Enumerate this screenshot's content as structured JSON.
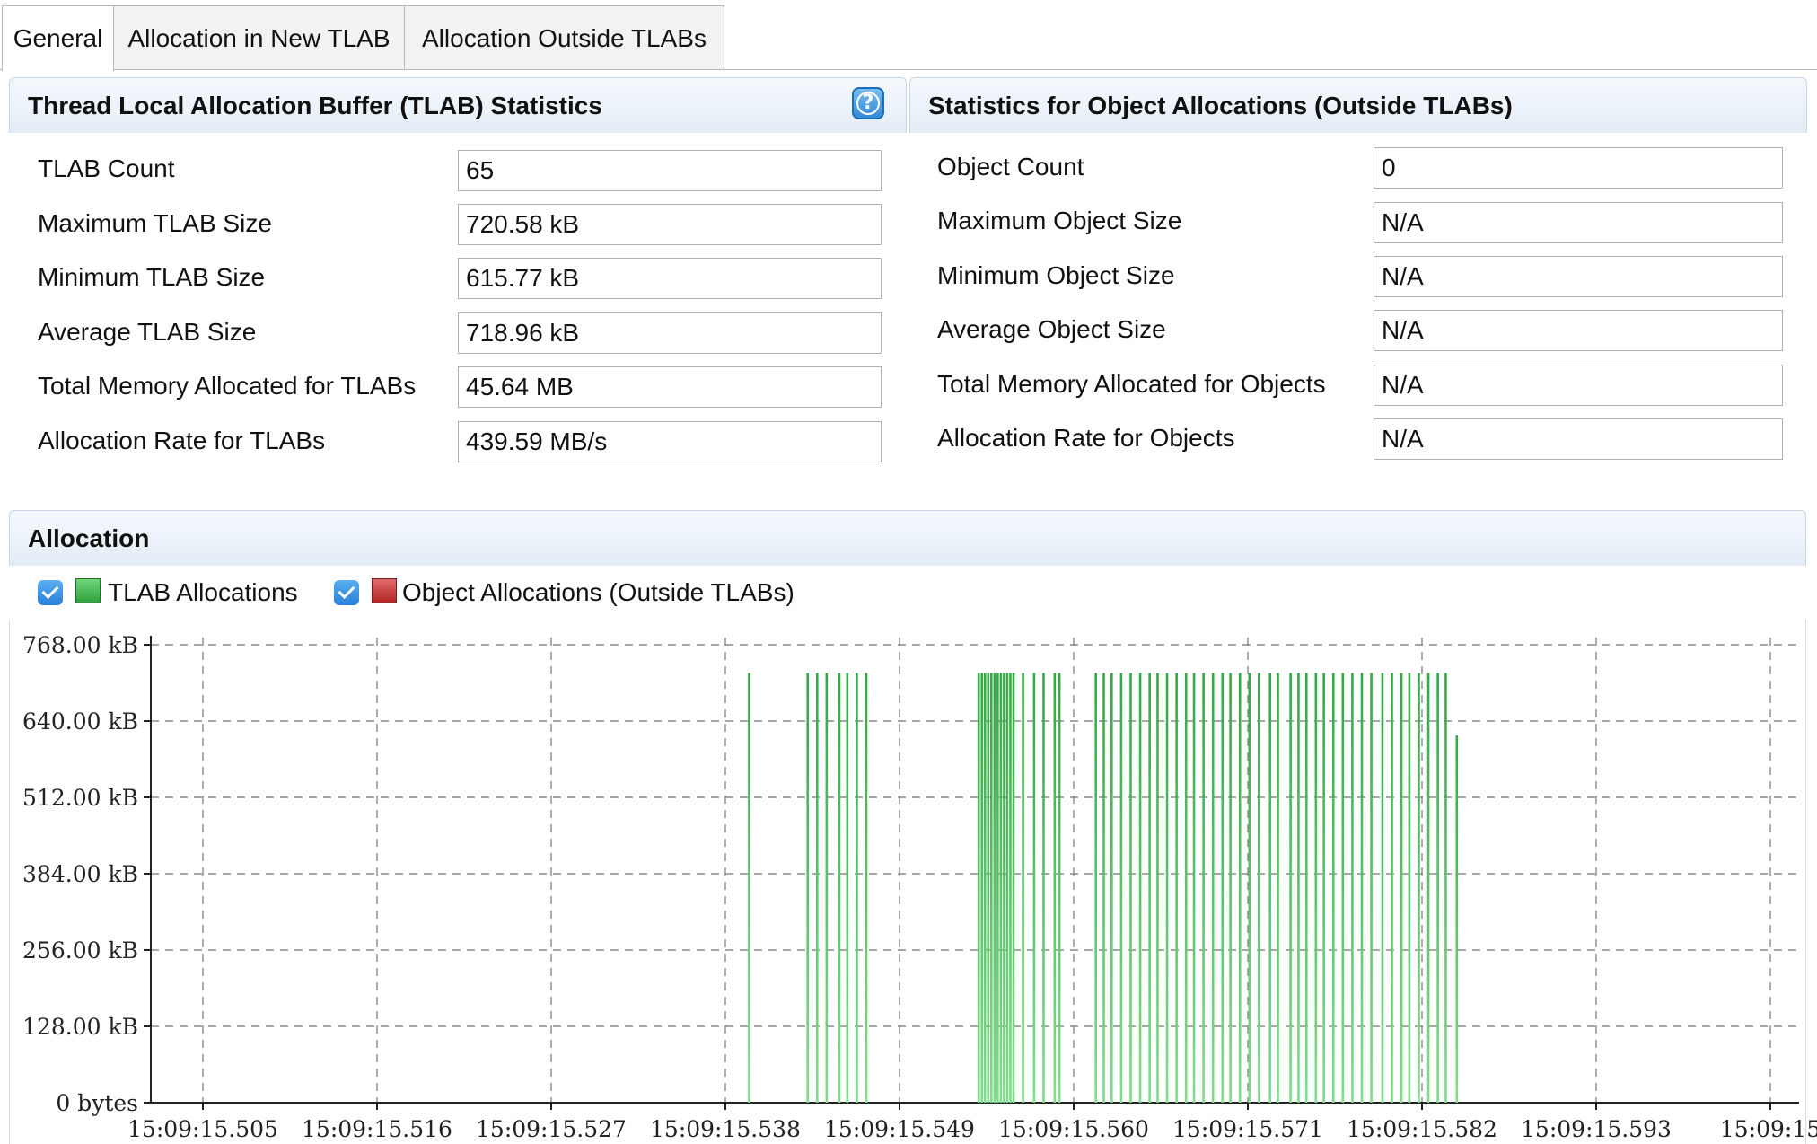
{
  "tabs": [
    "General",
    "Allocation in New TLAB",
    "Allocation Outside TLABs"
  ],
  "tlab_stats": {
    "title": "Thread Local Allocation Buffer (TLAB) Statistics",
    "rows": [
      {
        "label": "TLAB Count",
        "value": "65"
      },
      {
        "label": "Maximum TLAB Size",
        "value": "720.58 kB"
      },
      {
        "label": "Minimum TLAB Size",
        "value": "615.77 kB"
      },
      {
        "label": "Average TLAB Size",
        "value": "718.96 kB"
      },
      {
        "label": "Total Memory Allocated for TLABs",
        "value": "45.64 MB"
      },
      {
        "label": "Allocation Rate for TLABs",
        "value": "439.59 MB/s"
      }
    ]
  },
  "object_stats": {
    "title": "Statistics for Object Allocations (Outside TLABs)",
    "rows": [
      {
        "label": "Object Count",
        "value": "0"
      },
      {
        "label": "Maximum Object Size",
        "value": "N/A"
      },
      {
        "label": "Minimum Object Size",
        "value": "N/A"
      },
      {
        "label": "Average Object Size",
        "value": "N/A"
      },
      {
        "label": "Total Memory Allocated for Objects",
        "value": "N/A"
      },
      {
        "label": "Allocation Rate for Objects",
        "value": "N/A"
      }
    ]
  },
  "allocation": {
    "title": "Allocation",
    "legend": [
      {
        "label": "TLAB Allocations",
        "checked": true,
        "color": "#3cb84a"
      },
      {
        "label": "Object Allocations (Outside TLABs)",
        "checked": true,
        "color": "#c83232"
      }
    ]
  },
  "chart_data": {
    "type": "bar",
    "y_tick_labels": [
      "768.00 kB",
      "640.00 kB",
      "512.00 kB",
      "384.00 kB",
      "256.00 kB",
      "128.00 kB",
      "0 bytes"
    ],
    "x_tick_labels": [
      "15:09:15.505",
      "15:09:15.516",
      "15:09:15.527",
      "15:09:15.538",
      "15:09:15.549",
      "15:09:15.560",
      "15:09:15.571",
      "15:09:15.582",
      "15:09:15.593",
      "15:09:15"
    ],
    "ylim_kb": [
      0,
      768
    ],
    "grid": true,
    "series": [
      {
        "name": "TLAB Allocations",
        "color": "#3cb84a",
        "points_ms": [
          15.5395,
          15.5432,
          15.5438,
          15.5444,
          15.5452,
          15.5457,
          15.5463,
          15.5469,
          15.554,
          15.5542,
          15.5544,
          15.5546,
          15.5548,
          15.555,
          15.5552,
          15.5554,
          15.5556,
          15.5558,
          15.556,
          15.5562,
          15.5568,
          15.5575,
          15.5581,
          15.5588,
          15.5591,
          15.5614,
          15.5619,
          15.5624,
          15.563,
          15.5636,
          15.5642,
          15.5648,
          15.5653,
          15.5659,
          15.5665,
          15.5671,
          15.5676,
          15.5682,
          15.5688,
          15.5694,
          15.5699,
          15.5705,
          15.5711,
          15.5717,
          15.5724,
          15.5729,
          15.5737,
          15.5742,
          15.5747,
          15.5753,
          15.5758,
          15.5764,
          15.577,
          15.5776,
          15.5782,
          15.5788,
          15.5795,
          15.5801,
          15.5807,
          15.5812,
          15.5818,
          15.5824,
          15.583,
          15.5835,
          15.5842
        ],
        "values_kb": [
          720.58,
          720.58,
          720.58,
          720.58,
          720.58,
          720.58,
          720.58,
          720.58,
          720.58,
          720.58,
          720.58,
          720.58,
          720.58,
          720.58,
          720.58,
          720.58,
          720.58,
          720.58,
          720.58,
          720.58,
          720.58,
          720.58,
          720.58,
          720.58,
          720.58,
          720.58,
          720.58,
          720.58,
          720.58,
          720.58,
          720.58,
          720.58,
          720.58,
          720.58,
          720.58,
          720.58,
          720.58,
          720.58,
          720.58,
          720.58,
          720.58,
          720.58,
          720.58,
          720.58,
          720.58,
          720.58,
          720.58,
          720.58,
          720.58,
          720.58,
          720.58,
          720.58,
          720.58,
          720.58,
          720.58,
          720.58,
          720.58,
          720.58,
          720.58,
          720.58,
          720.58,
          720.58,
          720.58,
          720.58,
          615.77
        ]
      },
      {
        "name": "Object Allocations (Outside TLABs)",
        "color": "#c83232",
        "points_ms": [],
        "values_kb": []
      }
    ]
  }
}
